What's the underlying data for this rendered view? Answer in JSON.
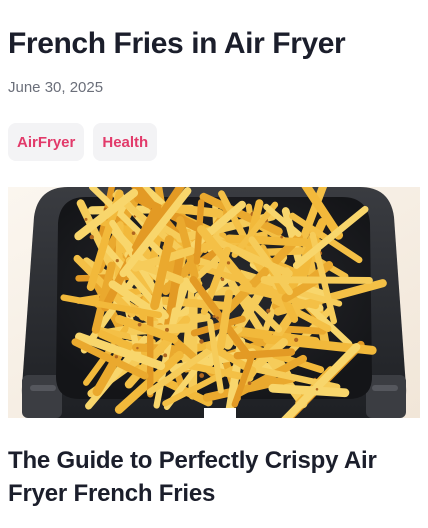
{
  "post": {
    "title": "French Fries in Air Fryer",
    "date": "June 30, 2025",
    "tags": [
      "AirFryer",
      "Health"
    ],
    "headline": "The Guide to Perfectly Crispy Air Fryer French Fries"
  },
  "colors": {
    "tag_text": "#e23a6a",
    "tag_bg": "#f3f3f5",
    "basket": "#2b2d31",
    "fries": "#f0b53a"
  }
}
